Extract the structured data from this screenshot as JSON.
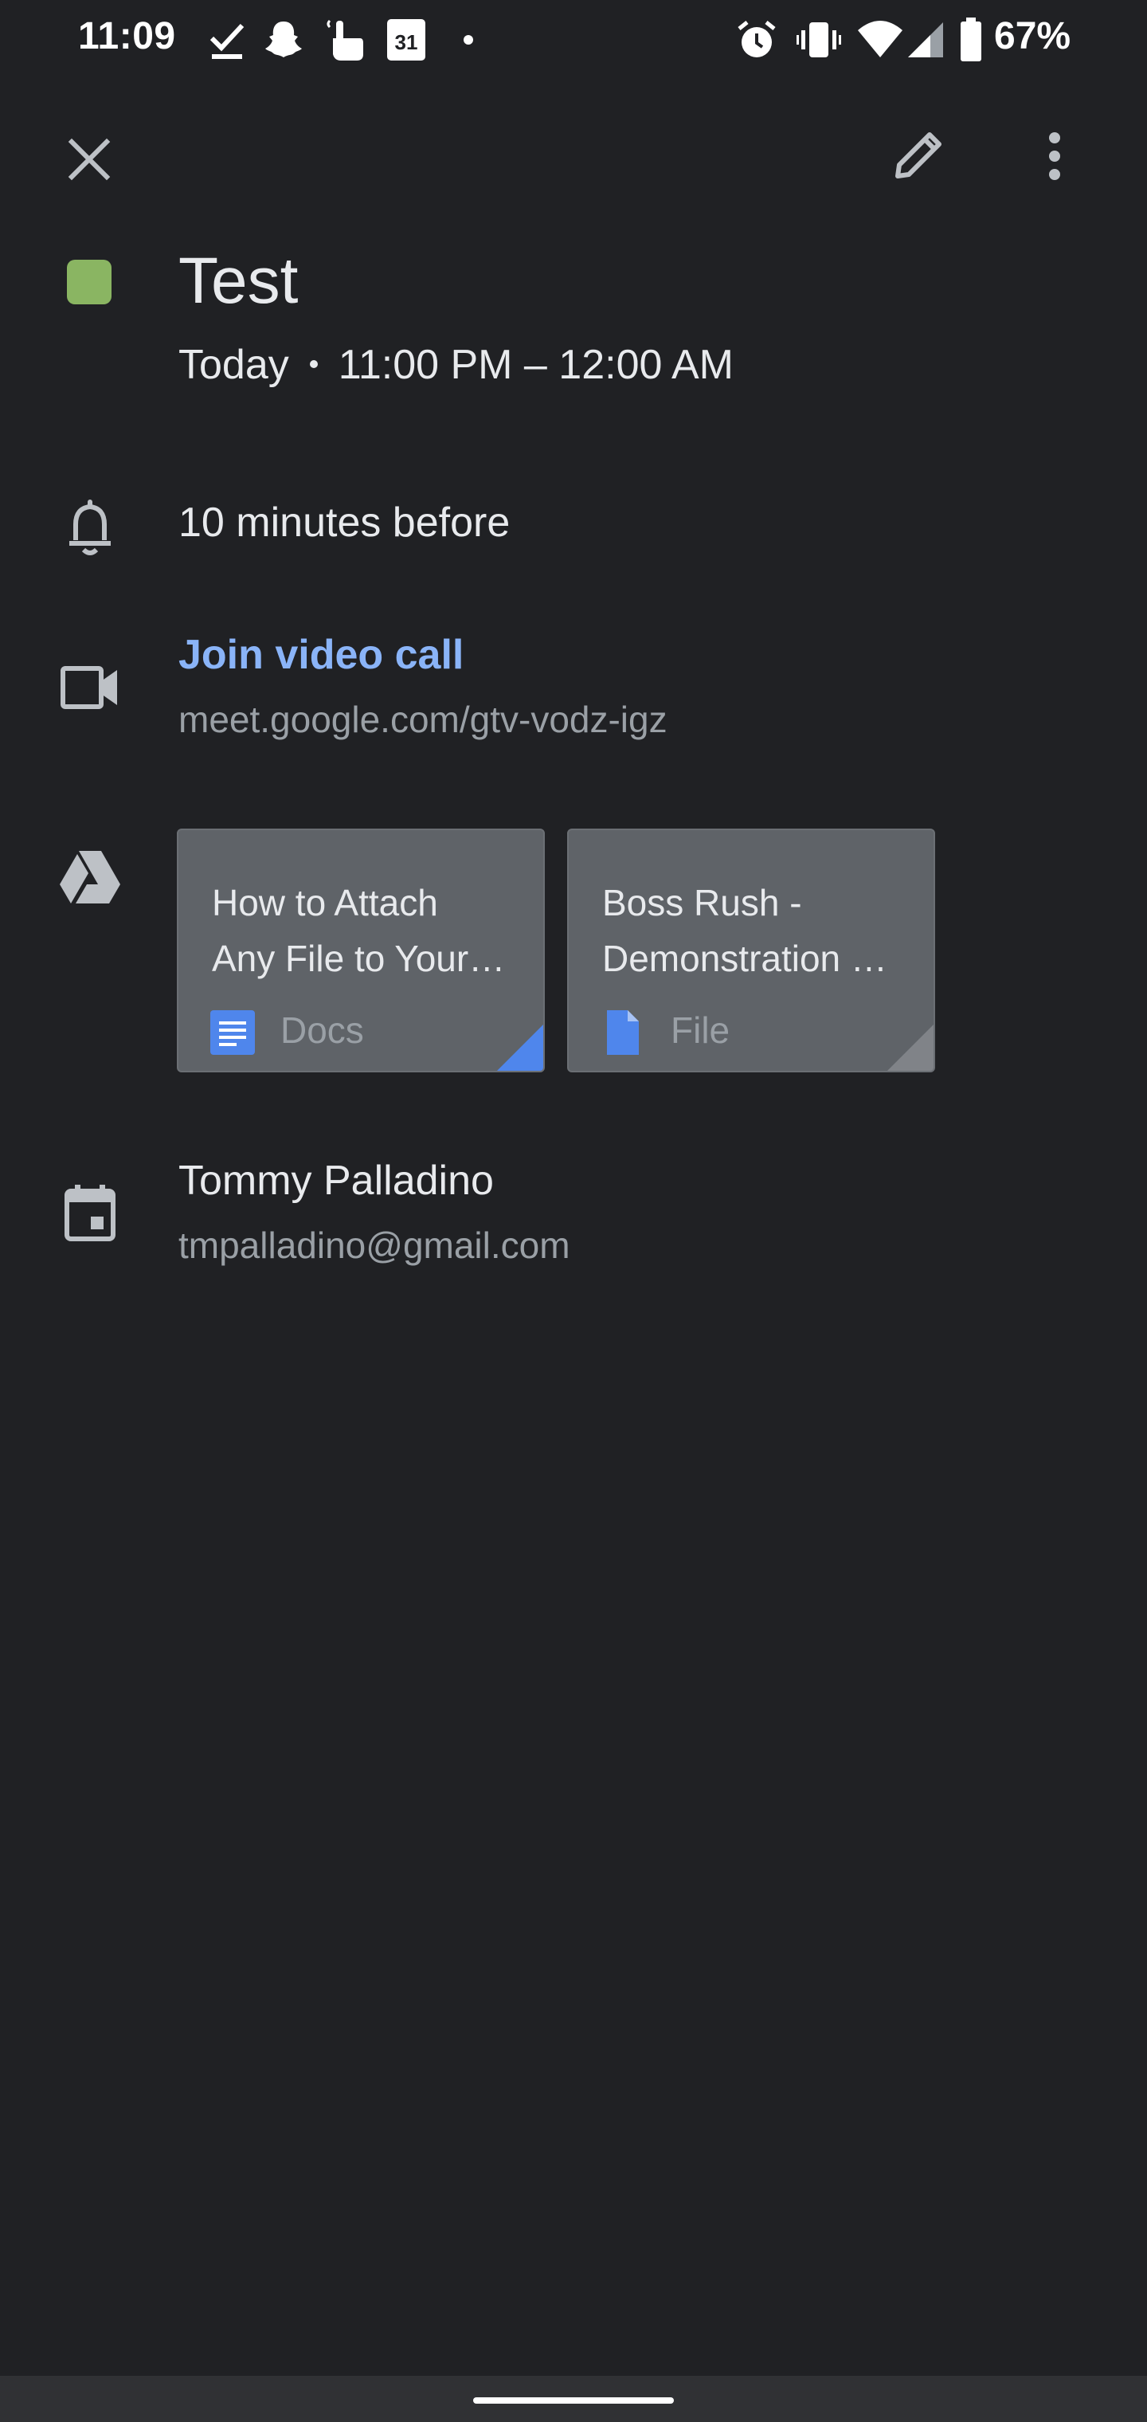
{
  "status_bar": {
    "time": "11:09",
    "battery": "67%",
    "left_icons": [
      "check-icon",
      "snapchat-ghost-icon",
      "touch-hand-icon",
      "calendar-31-icon",
      "dot-icon"
    ],
    "right_icons": [
      "alarm-icon",
      "vibrate-icon",
      "wifi-icon",
      "signal-icon",
      "battery-icon"
    ],
    "calendar_icon_text": "31"
  },
  "app_bar": {
    "close_icon": "close-icon",
    "edit_icon": "pencil-icon",
    "menu_icon": "more-vert-icon"
  },
  "event": {
    "title": "Test",
    "color": "#8ab562",
    "day": "Today",
    "time_range": "11:00 PM – 12:00 AM"
  },
  "reminder": {
    "icon": "bell-icon",
    "text": "10 minutes before"
  },
  "video_call": {
    "icon": "video-camera-icon",
    "label": "Join video call",
    "url": "meet.google.com/gtv-vodz-igz"
  },
  "attachments": {
    "icon": "google-drive-icon",
    "items": [
      {
        "title_line1": "How to Attach",
        "title_line2": "Any File to Your…",
        "type": "Docs",
        "type_icon": "google-docs-icon",
        "corner_color": "#4f86ec"
      },
      {
        "title_line1": "Boss Rush -",
        "title_line2": "Demonstration …",
        "type": "File",
        "type_icon": "file-icon",
        "corner_color": "#808388"
      }
    ]
  },
  "organizer": {
    "icon": "calendar-icon",
    "name": "Tommy Palladino",
    "email": "tmpalladino@gmail.com"
  }
}
